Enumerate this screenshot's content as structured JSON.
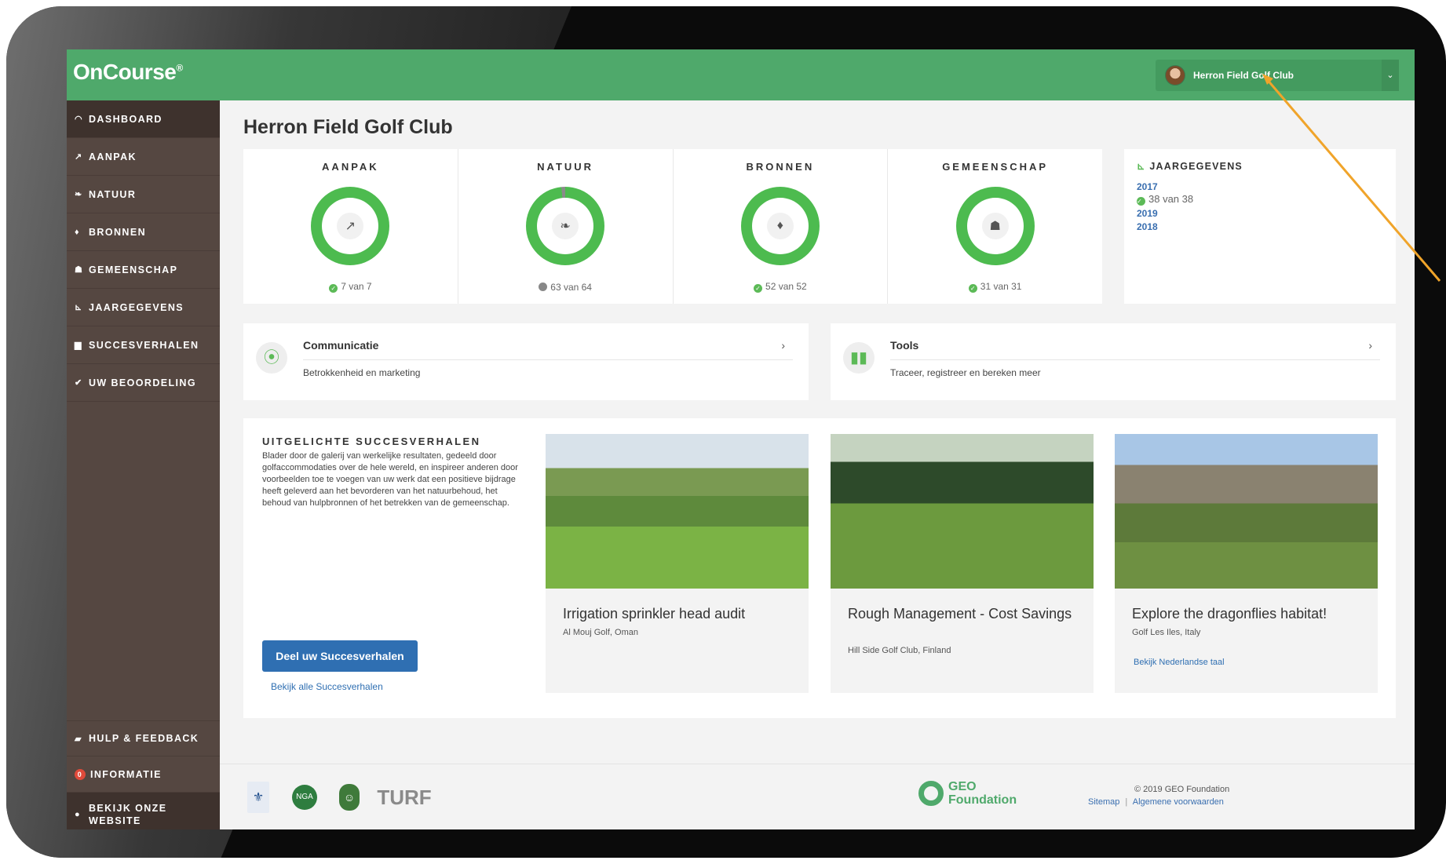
{
  "app": {
    "logo": "OnCourse",
    "logo_mark": "®"
  },
  "header": {
    "user_name": "Herron Field Golf Club",
    "caret": "⌄"
  },
  "sidebar": {
    "items": [
      {
        "icon": "dashboard-icon",
        "glyph": "◠",
        "label": "DASHBOARD"
      },
      {
        "icon": "aanpak-icon",
        "glyph": "↗",
        "label": "AANPAK"
      },
      {
        "icon": "leaf-icon",
        "glyph": "❧",
        "label": "NATUUR"
      },
      {
        "icon": "drop-icon",
        "glyph": "♦",
        "label": "BRONNEN"
      },
      {
        "icon": "community-icon",
        "glyph": "☗",
        "label": "GEMEENSCHAP"
      },
      {
        "icon": "chart-icon",
        "glyph": "⊾",
        "label": "JAARGEGEVENS"
      },
      {
        "icon": "book-icon",
        "glyph": "▆",
        "label": "SUCCESVERHALEN"
      },
      {
        "icon": "check-circle-icon",
        "glyph": "✔",
        "label": "UW BEOORDELING"
      }
    ],
    "bottom": {
      "help": "HULP & FEEDBACK",
      "info": "INFORMATIE",
      "info_badge": "0",
      "website": "BEKIJK ONZE WEBSITE"
    }
  },
  "main": {
    "title": "Herron Field Golf Club",
    "stats": [
      {
        "label": "AANPAK",
        "count": "7 van 7",
        "done": 7,
        "total": 7,
        "status": "complete",
        "glyph": "↗"
      },
      {
        "label": "NATUUR",
        "count": "63 van 64",
        "done": 63,
        "total": 64,
        "status": "incomplete",
        "glyph": "❧"
      },
      {
        "label": "BRONNEN",
        "count": "52 van 52",
        "done": 52,
        "total": 52,
        "status": "complete",
        "glyph": "♦"
      },
      {
        "label": "GEMEENSCHAP",
        "count": "31 van 31",
        "done": 31,
        "total": 31,
        "status": "complete",
        "glyph": "☗"
      }
    ],
    "years": {
      "title": "JAARGEGEVENS",
      "entries": [
        {
          "year": "2017",
          "sub": "38 van 38"
        },
        {
          "year": "2019"
        },
        {
          "year": "2018"
        }
      ]
    },
    "cards": [
      {
        "title": "Communicatie",
        "desc": "Betrokkenheid en marketing",
        "arrow": "›"
      },
      {
        "title": "Tools",
        "desc": "Traceer, registreer en bereken meer",
        "arrow": "›"
      }
    ],
    "stories": {
      "heading": "UITGELICHTE SUCCESVERHALEN",
      "intro": "Blader door de galerij van werkelijke resultaten, gedeeld door golfaccommodaties over de hele wereld, en inspireer anderen door voorbeelden toe te voegen van uw werk dat een positieve bijdrage heeft geleverd aan het bevorderen van het natuurbehoud, het behoud van hulpbronnen of het betrekken van de gemeenschap.",
      "share_button": "Deel uw Succesverhalen",
      "all_link": "Bekijk alle Succesverhalen",
      "items": [
        {
          "title": "Irrigation sprinkler head audit",
          "location": "Al Mouj Golf, Oman"
        },
        {
          "title": "Rough Management - Cost Savings",
          "location": "Hill Side Golf Club, Finland"
        },
        {
          "title": "Explore the dragonflies habitat!",
          "location": "Golf Les Iles, Italy",
          "link": "Bekijk Nederlandse taal"
        }
      ]
    }
  },
  "footer": {
    "partner_turf": "TURF",
    "geo_line1": "GEO",
    "geo_line2": "Foundation",
    "copyright": "© 2019 GEO Foundation",
    "sitemap": "Sitemap",
    "separator": "|",
    "terms": "Algemene voorwaarden"
  },
  "colors": {
    "brand_green": "#4fa96b",
    "sidebar": "#554741",
    "link_blue": "#2f6fb2",
    "ring_green": "#4dbb4f",
    "ring_grey": "#8a8a8a"
  }
}
